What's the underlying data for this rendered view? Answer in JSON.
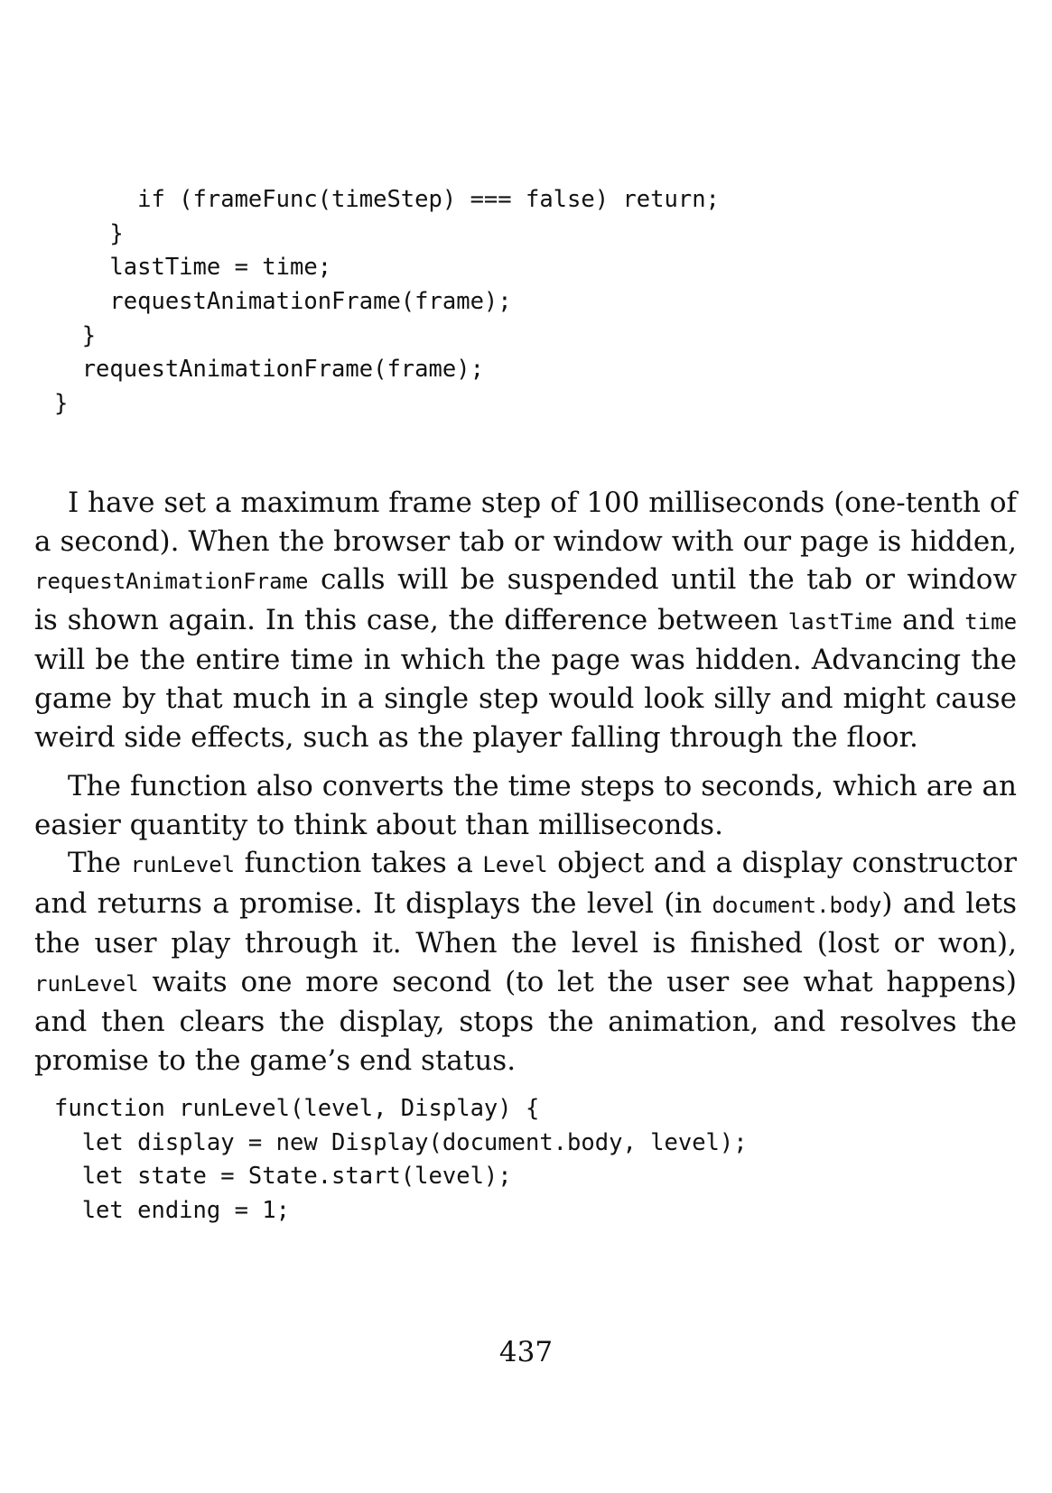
{
  "code_top": [
    "      if (frameFunc(timeStep) === false) return;",
    "    }",
    "    lastTime = time;",
    "    requestAnimationFrame(frame);",
    "  }",
    "  requestAnimationFrame(frame);",
    "}"
  ],
  "para_1": {
    "t1": "I have set a maximum frame step of 100 milliseconds (one-tenth of a second). When the browser tab or window with our page is hidden, ",
    "c1": "requestAnimationFrame",
    "t2": " calls will be suspended until the tab or window is shown again. In this case, the difference between ",
    "c2": "lastTime",
    "t3": " and ",
    "c3": "time",
    "t4": " will be the entire time in which the page was hidden. Advancing the game by that much in a single step would look silly and might cause weird side effects, such as the player falling through the floor."
  },
  "para_2": {
    "t1": "The function also converts the time steps to seconds, which are an easier quantity to think about than milliseconds."
  },
  "para_3": {
    "t1": "The ",
    "c1": "runLevel",
    "t2": " function takes a ",
    "c2": "Level",
    "t3": " object and a display constructor and returns a promise. It displays the level (in ",
    "c3": "document.body",
    "t4": ") and lets the user play through it. When the level is finished (lost or won), ",
    "c4": "runLevel",
    "t5": " waits one more second (to let the user see what happens) and then clears the display, stops the animation, and resolves the promise to the game’s end status."
  },
  "code_bottom": [
    "function runLevel(level, Display) {",
    "  let display = new Display(document.body, level);",
    "  let state = State.start(level);",
    "  let ending = 1;"
  ],
  "page_number": "437"
}
